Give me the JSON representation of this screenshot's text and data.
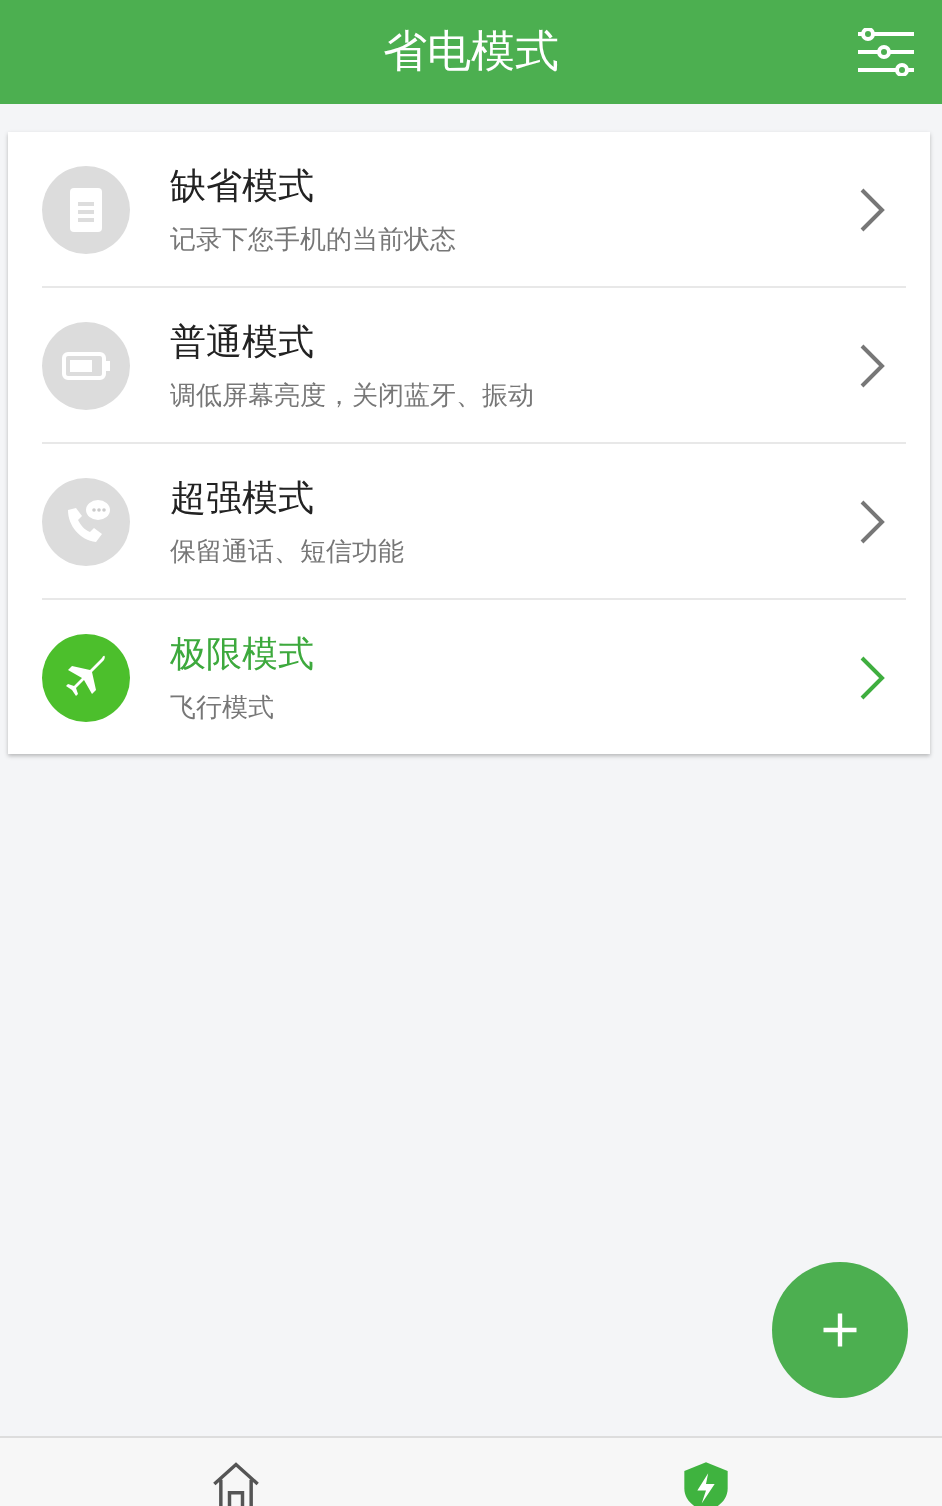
{
  "header": {
    "title": "省电模式"
  },
  "modes": [
    {
      "kind": "document",
      "title": "缺省模式",
      "subtitle": "记录下您手机的当前状态",
      "selected": false
    },
    {
      "kind": "battery",
      "title": "普通模式",
      "subtitle": "调低屏幕亮度，关闭蓝牙、振动",
      "selected": false
    },
    {
      "kind": "phone",
      "title": "超强模式",
      "subtitle": "保留通话、短信功能",
      "selected": false
    },
    {
      "kind": "airplane",
      "title": "极限模式",
      "subtitle": "飞行模式",
      "selected": true
    }
  ],
  "bottom_nav": [
    {
      "kind": "home",
      "selected": false
    },
    {
      "kind": "shield",
      "selected": true
    }
  ]
}
